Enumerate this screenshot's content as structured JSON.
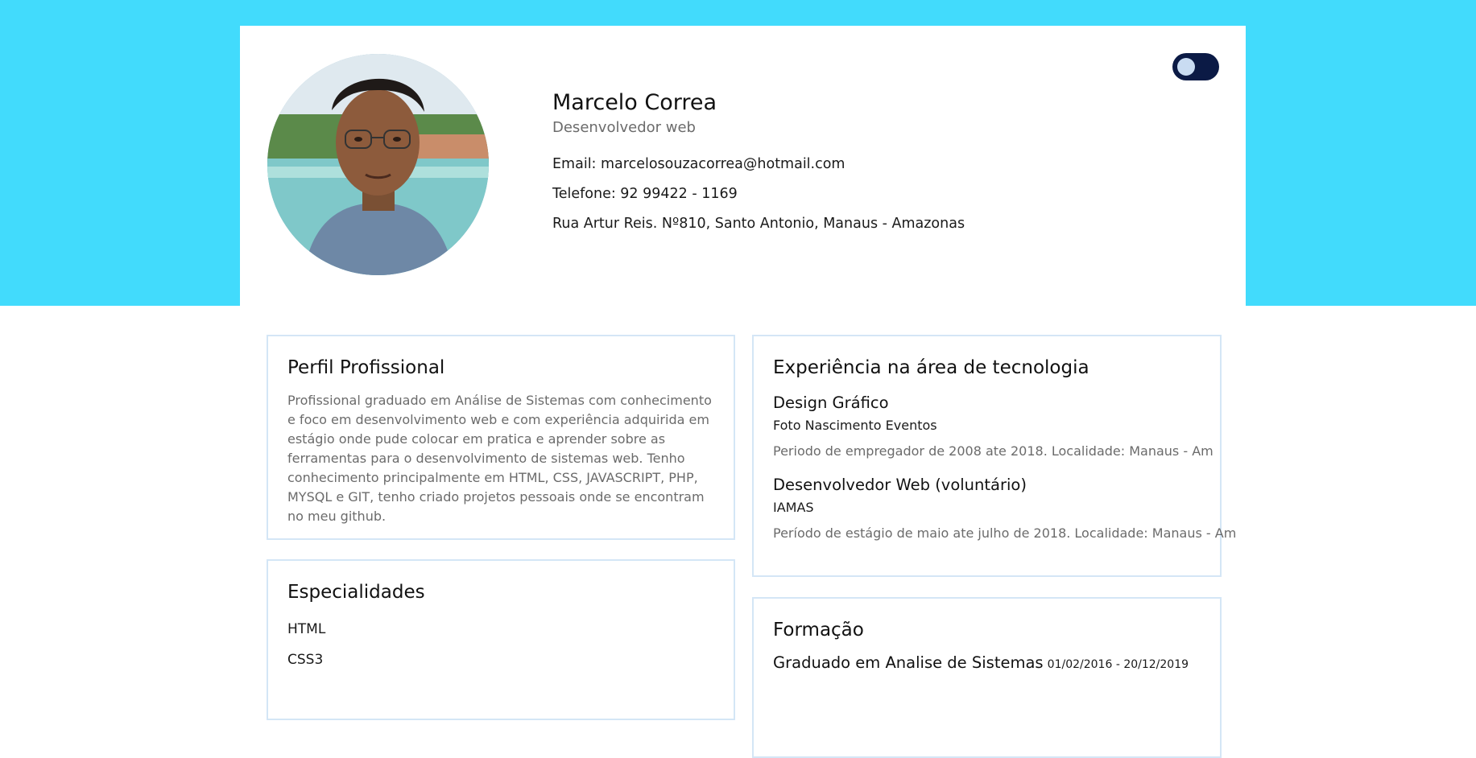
{
  "header": {
    "name": "Marcelo Correa",
    "role": "Desenvolvedor web",
    "email": "Email: marcelosouzacorrea@hotmail.com",
    "phone": "Telefone: 92 99422 - 1169",
    "address": "Rua Artur Reis. Nº810, Santo Antonio, Manaus - Amazonas"
  },
  "colors": {
    "hero_background": "#42dbfc",
    "toggle_track": "#0b1a45",
    "toggle_knob": "#c9dcf2",
    "card_border": "#d4e6f6"
  },
  "icons": {
    "avatar": "profile-photo",
    "theme_toggle": "dark-mode-toggle"
  },
  "profile": {
    "title": "Perfil Profissional",
    "text": "Profissional graduado em Análise de Sistemas com conhecimento e foco em desenvolvimento web e com experiência adquirida em estágio onde pude colocar em pratica e aprender sobre as ferramentas para o desenvolvimento de sistemas web. Tenho conhecimento principalmente em HTML, CSS, JAVASCRIPT, PHP, MYSQL e GIT, tenho criado projetos pessoais onde se encontram no meu github."
  },
  "skills": {
    "title": "Especialidades",
    "items": [
      "HTML",
      "CSS3"
    ]
  },
  "experience": {
    "title": "Experiência na área de tecnologia",
    "jobs": [
      {
        "title": "Design Gráfico",
        "company": "Foto Nascimento Eventos",
        "period": "Periodo de empregador de 2008 ate 2018. Localidade: Manaus - Am"
      },
      {
        "title": "Desenvolvedor Web (voluntário)",
        "company": "IAMAS",
        "period": "Período de estágio de maio ate julho de 2018. Localidade: Manaus - Am"
      }
    ]
  },
  "education": {
    "title": "Formação",
    "degree": "Graduado em Analise de Sistemas",
    "dates": "01/02/2016 - 20/12/2019"
  }
}
